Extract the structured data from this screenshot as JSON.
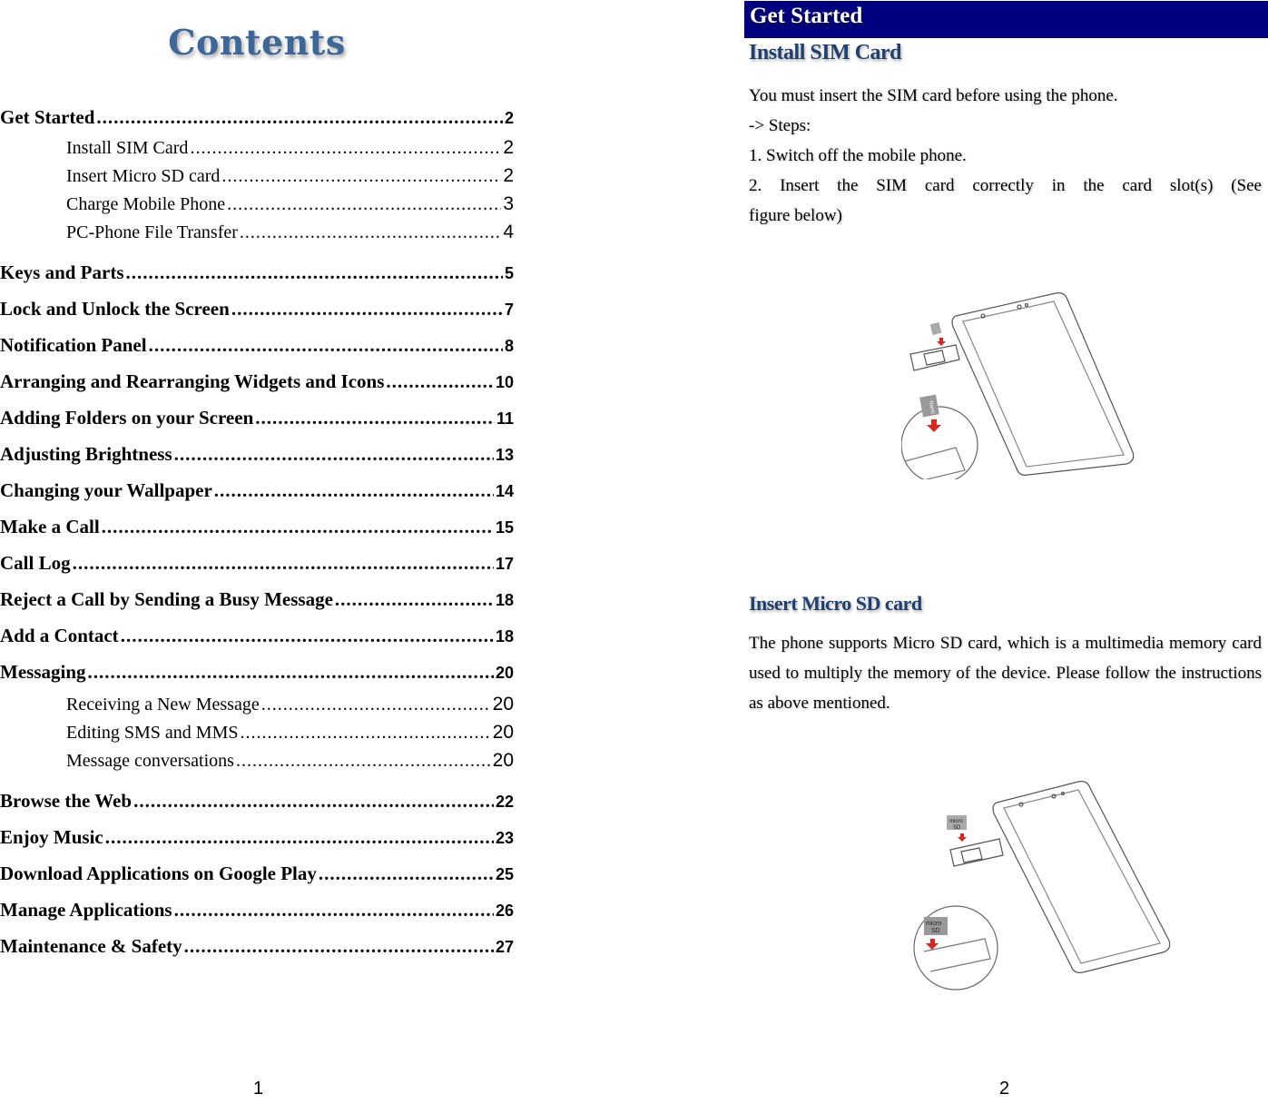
{
  "left_page": {
    "title": "Contents",
    "page_number": "1",
    "toc": [
      {
        "level": 1,
        "text": "Get Started",
        "page": "2"
      },
      {
        "level": 2,
        "text": "Install SIM Card",
        "page": "2"
      },
      {
        "level": 2,
        "text": "Insert Micro SD card",
        "page": "2"
      },
      {
        "level": 2,
        "text": "Charge Mobile Phone",
        "page": "3"
      },
      {
        "level": 2,
        "text": "PC-Phone File Transfer",
        "page": "4"
      },
      {
        "level": 1,
        "text": "Keys and Parts",
        "page": "5"
      },
      {
        "level": 1,
        "text": "Lock and Unlock the Screen",
        "page": "7"
      },
      {
        "level": 1,
        "text": "Notification Panel",
        "page": "8"
      },
      {
        "level": 1,
        "text": "Arranging and Rearranging Widgets and Icons",
        "page": "10"
      },
      {
        "level": 1,
        "text": "Adding Folders on your Screen",
        "page": "11"
      },
      {
        "level": 1,
        "text": "Adjusting Brightness",
        "page": "13"
      },
      {
        "level": 1,
        "text": "Changing your Wallpaper",
        "page": "14"
      },
      {
        "level": 1,
        "text": "Make a Call",
        "page": "15"
      },
      {
        "level": 1,
        "text": "Call Log",
        "page": "17"
      },
      {
        "level": 1,
        "text": "Reject a Call by Sending a Busy Message",
        "page": "18"
      },
      {
        "level": 1,
        "text": "Add a Contact",
        "page": "18"
      },
      {
        "level": 1,
        "text": "Messaging",
        "page": "20"
      },
      {
        "level": 2,
        "text": "Receiving a New Message",
        "page": "20"
      },
      {
        "level": 2,
        "text": "Editing SMS and MMS",
        "page": "20"
      },
      {
        "level": 2,
        "text": "Message conversations",
        "page": "20"
      },
      {
        "level": 1,
        "text": "Browse the Web",
        "page": "22"
      },
      {
        "level": 1,
        "text": "Enjoy Music",
        "page": "23"
      },
      {
        "level": 1,
        "text": "Download Applications on Google Play",
        "page": "25"
      },
      {
        "level": 1,
        "text": "Manage Applications",
        "page": "26"
      },
      {
        "level": 1,
        "text": "Maintenance & Safety",
        "page": "27"
      }
    ]
  },
  "right_page": {
    "page_number": "2",
    "section_title": "Get Started",
    "banner_color": "#000080",
    "heading_color": "#1f3f6e",
    "install_sim": {
      "heading": "Install SIM Card",
      "lines": [
        "You must insert the SIM card before using the phone.",
        "-> Steps:",
        "1. Switch off the mobile phone.",
        "2. Insert the SIM card correctly in the card slot(s) (See",
        "figure below)"
      ],
      "figure": {
        "card_label_line1": "Nano",
        "card_label_line2": "SIM"
      }
    },
    "insert_sd": {
      "heading": "Insert Micro SD card",
      "paragraph": "The phone supports Micro SD card, which is a multimedia memory card used to multiply the memory of the device. Please follow the instructions as above mentioned.",
      "figure": {
        "card_label_line1": "micro",
        "card_label_line2": "SD"
      }
    }
  }
}
